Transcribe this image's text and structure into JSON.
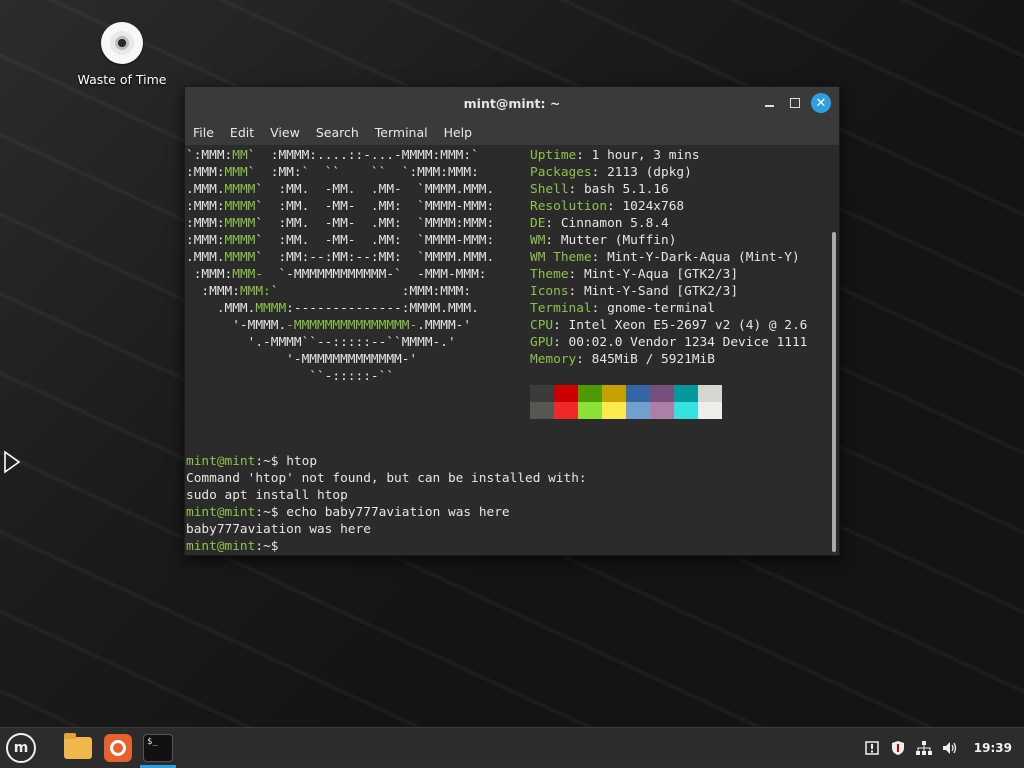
{
  "desktop": {
    "icons": [
      {
        "label": "Waste of Time",
        "icon": "cd-disc-icon"
      }
    ]
  },
  "window": {
    "title": "mint@mint: ~",
    "menu": [
      "File",
      "Edit",
      "View",
      "Search",
      "Terminal",
      "Help"
    ],
    "controls": {
      "minimize": "minimize",
      "maximize": "maximize",
      "close": "✕"
    }
  },
  "terminal": {
    "ascii_art": [
      [
        [
          "w",
          "`:MMM:"
        ],
        [
          "g",
          "MM"
        ],
        [
          "w",
          "`  :MMMM:....::-...-MMMM:MMM:`"
        ]
      ],
      [
        [
          "w",
          ":MMM:"
        ],
        [
          "g",
          "MMM"
        ],
        [
          "w",
          "`  :MM:`  ``    ``  `:MMM:MMM:"
        ]
      ],
      [
        [
          "w",
          ".MMM."
        ],
        [
          "g",
          "MMMM"
        ],
        [
          "w",
          "`  :MM.  -MM.  .MM-  `MMMM.MMM."
        ]
      ],
      [
        [
          "w",
          ":MMM:"
        ],
        [
          "g",
          "MMMM"
        ],
        [
          "w",
          "`  :MM.  -MM-  .MM:  `MMMM-MMM:"
        ]
      ],
      [
        [
          "w",
          ":MMM:"
        ],
        [
          "g",
          "MMMM"
        ],
        [
          "w",
          "`  :MM.  -MM-  .MM:  `MMMM:MMM:"
        ]
      ],
      [
        [
          "w",
          ":MMM:"
        ],
        [
          "g",
          "MMMM"
        ],
        [
          "w",
          "`  :MM.  -MM-  .MM:  `MMMM-MMM:"
        ]
      ],
      [
        [
          "w",
          ".MMM."
        ],
        [
          "g",
          "MMMM"
        ],
        [
          "w",
          "`  :MM:--:MM:--:MM:  `MMMM.MMM."
        ]
      ],
      [
        [
          "w",
          " :MMM:"
        ],
        [
          "g",
          "MMM-"
        ],
        [
          "w",
          "  `-MMMMMMMMMMMM-`  -MMM-MMM:"
        ]
      ],
      [
        [
          "w",
          "  :MMM:"
        ],
        [
          "g",
          "MMM:"
        ],
        [
          "w",
          "`                :MMM:MMM:"
        ]
      ],
      [
        [
          "w",
          "    .MMM."
        ],
        [
          "g",
          "MMMM"
        ],
        [
          "w",
          ":--------------:MMMM.MMM."
        ]
      ],
      [
        [
          "w",
          "      '-MMMM."
        ],
        [
          "g",
          "-MMMMMMMMMMMMMMM-"
        ],
        [
          "w",
          ".MMMM-'"
        ]
      ],
      [
        [
          "w",
          "        '.-MMMM``--:::::--``MMMM-.'"
        ]
      ],
      [
        [
          "w",
          "             '-MMMMMMMMMMMMM-'"
        ]
      ],
      [
        [
          "w",
          "                ``-:::::-``"
        ]
      ]
    ],
    "info": [
      {
        "key": "Uptime",
        "value": "1 hour, 3 mins"
      },
      {
        "key": "Packages",
        "value": "2113 (dpkg)"
      },
      {
        "key": "Shell",
        "value": "bash 5.1.16"
      },
      {
        "key": "Resolution",
        "value": "1024x768"
      },
      {
        "key": "DE",
        "value": "Cinnamon 5.8.4"
      },
      {
        "key": "WM",
        "value": "Mutter (Muffin)"
      },
      {
        "key": "WM Theme",
        "value": "Mint-Y-Dark-Aqua (Mint-Y)"
      },
      {
        "key": "Theme",
        "value": "Mint-Y-Aqua [GTK2/3]"
      },
      {
        "key": "Icons",
        "value": "Mint-Y-Sand [GTK2/3]"
      },
      {
        "key": "Terminal",
        "value": "gnome-terminal"
      },
      {
        "key": "CPU",
        "value": "Intel Xeon E5-2697 v2 (4) @ 2.6"
      },
      {
        "key": "GPU",
        "value": "00:02.0 Vendor 1234 Device 1111"
      },
      {
        "key": "Memory",
        "value": "845MiB / 5921MiB"
      }
    ],
    "palette": [
      [
        "#3b3b3b",
        "#cc0000",
        "#4e9a06",
        "#c4a000",
        "#3465a4",
        "#75507b",
        "#06989a",
        "#d3d7cf"
      ],
      [
        "#555753",
        "#ef2929",
        "#8ae234",
        "#fce94f",
        "#729fcf",
        "#ad7fa8",
        "#34e2e2",
        "#eeeeec"
      ]
    ],
    "session": [
      {
        "prompt": "mint@mint",
        "path": "~",
        "cmd": "htop"
      },
      {
        "out": "Command 'htop' not found, but can be installed with:"
      },
      {
        "out": "sudo apt install htop"
      },
      {
        "prompt": "mint@mint",
        "path": "~",
        "cmd": "echo baby777aviation was here"
      },
      {
        "out": "baby777aviation was here"
      },
      {
        "prompt": "mint@mint",
        "path": "~",
        "cmd": ""
      }
    ]
  },
  "taskbar": {
    "menu_icon": "mint-logo-icon",
    "apps": [
      "files-folder-icon",
      "firefox-icon",
      "terminal-icon"
    ],
    "terminal_icon_text": "$_",
    "tray": [
      "update-manager-icon",
      "shield-icon",
      "network-icon",
      "volume-icon"
    ],
    "clock": "19:39"
  }
}
